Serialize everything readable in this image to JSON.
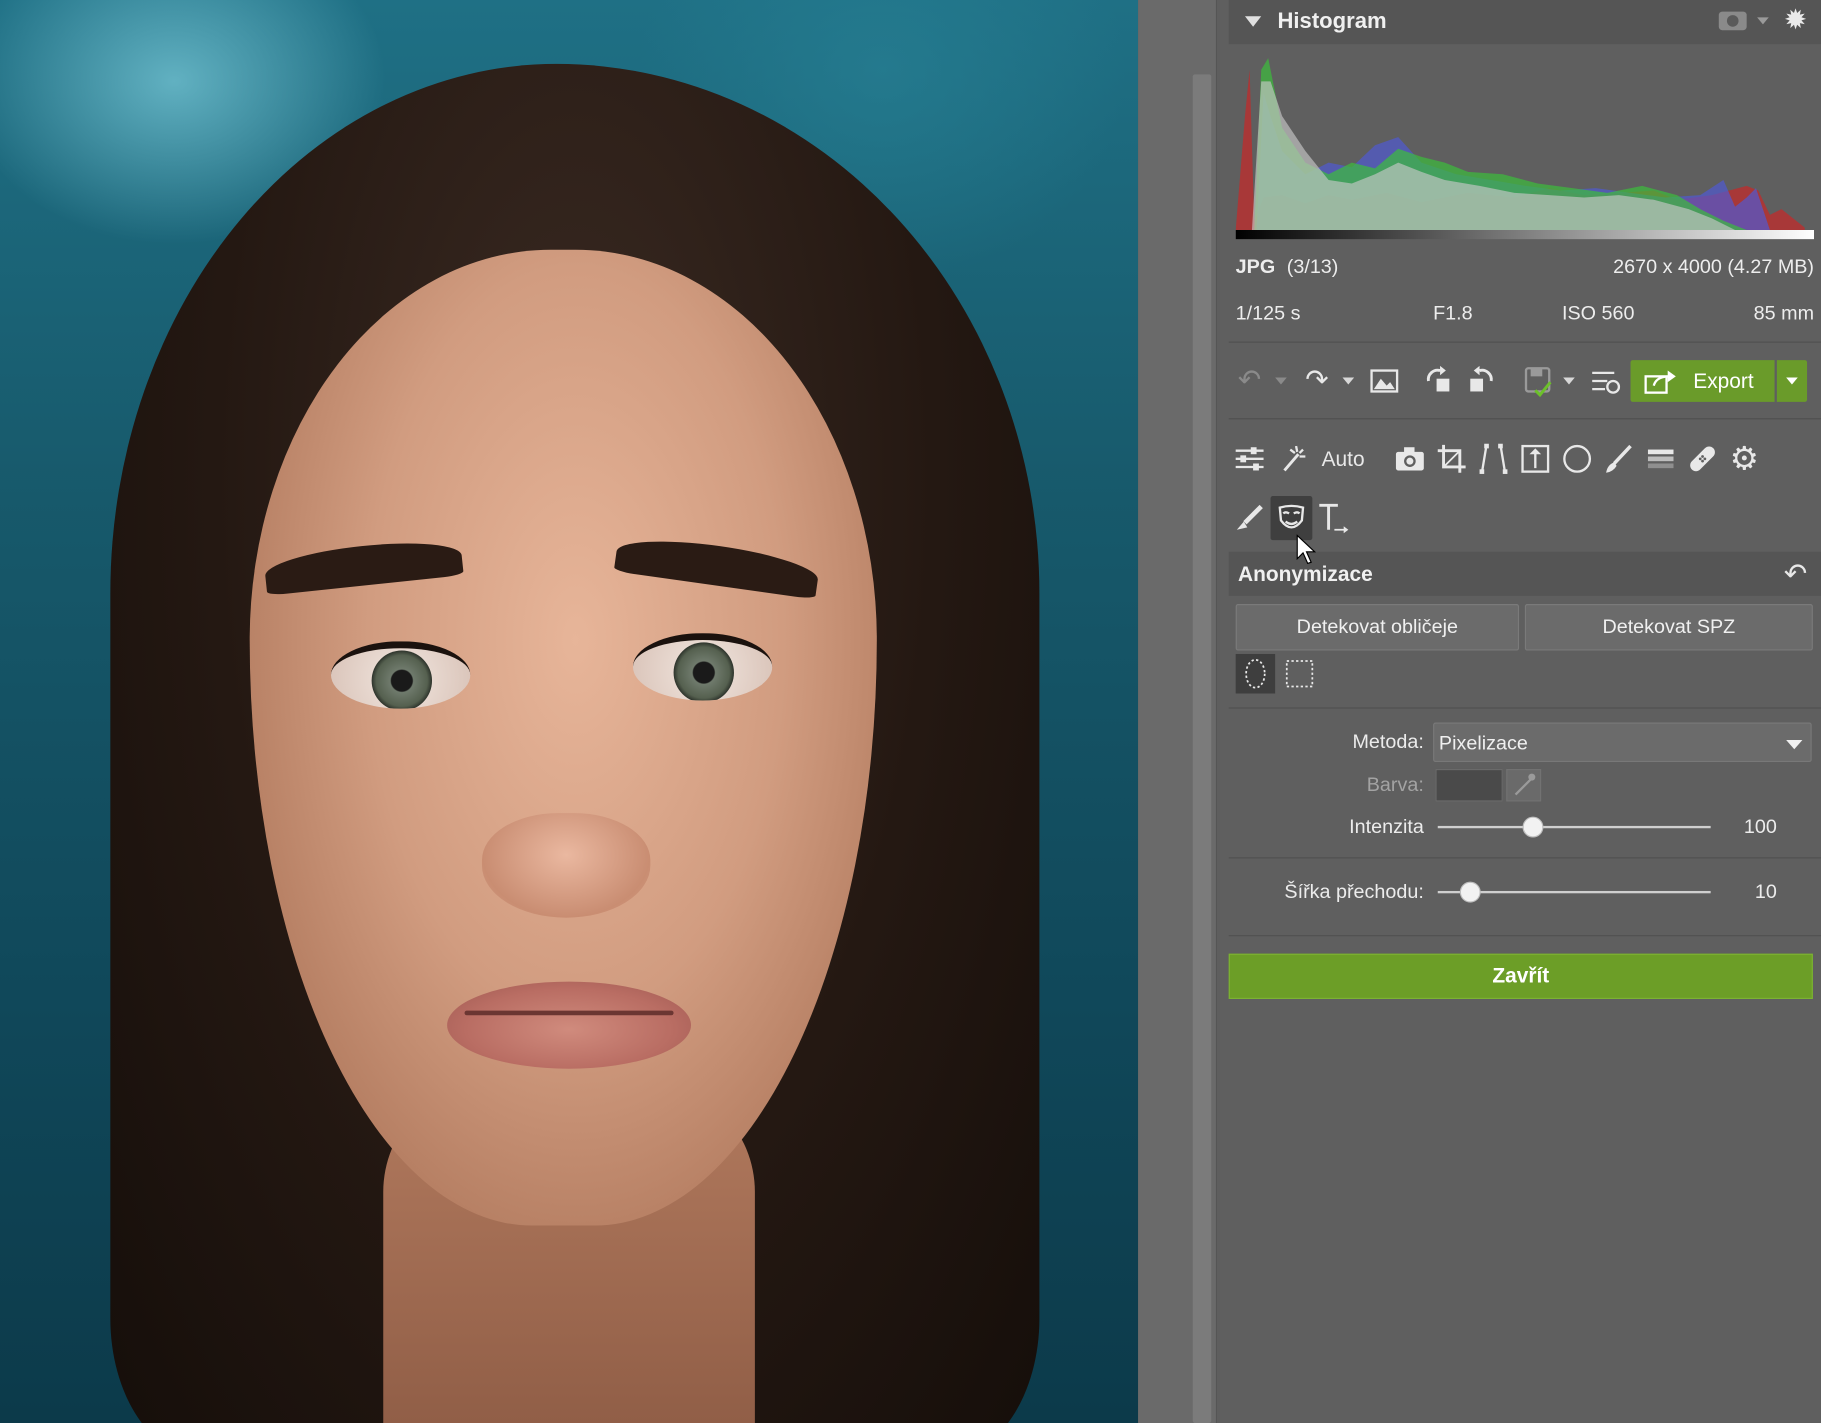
{
  "histogram": {
    "title": "Histogram"
  },
  "file_info": {
    "format": "JPG",
    "index": "(3/13)",
    "dimensions": "2670 x 4000 (4.27 MB)",
    "shutter": "1/125 s",
    "aperture": "F1.8",
    "iso": "ISO 560",
    "focal": "85 mm"
  },
  "toolbar": {
    "export_label": "Export",
    "auto_label": "Auto"
  },
  "section": {
    "title": "Anonymizace",
    "detect_faces": "Detekovat obličeje",
    "detect_plates": "Detekovat SPZ",
    "method_label": "Metoda:",
    "method_value": "Pixelizace",
    "color_label": "Barva:",
    "intensity_label": "Intenzita",
    "intensity_value": "100",
    "intensity_level": 0.35,
    "transition_label": "Šířka přechodu:",
    "transition_value": "10",
    "transition_level": 0.12,
    "close_label": "Zavřít"
  },
  "colors": {
    "accent_green": "#6c9e27",
    "panel_bg": "#5f5f5f"
  }
}
